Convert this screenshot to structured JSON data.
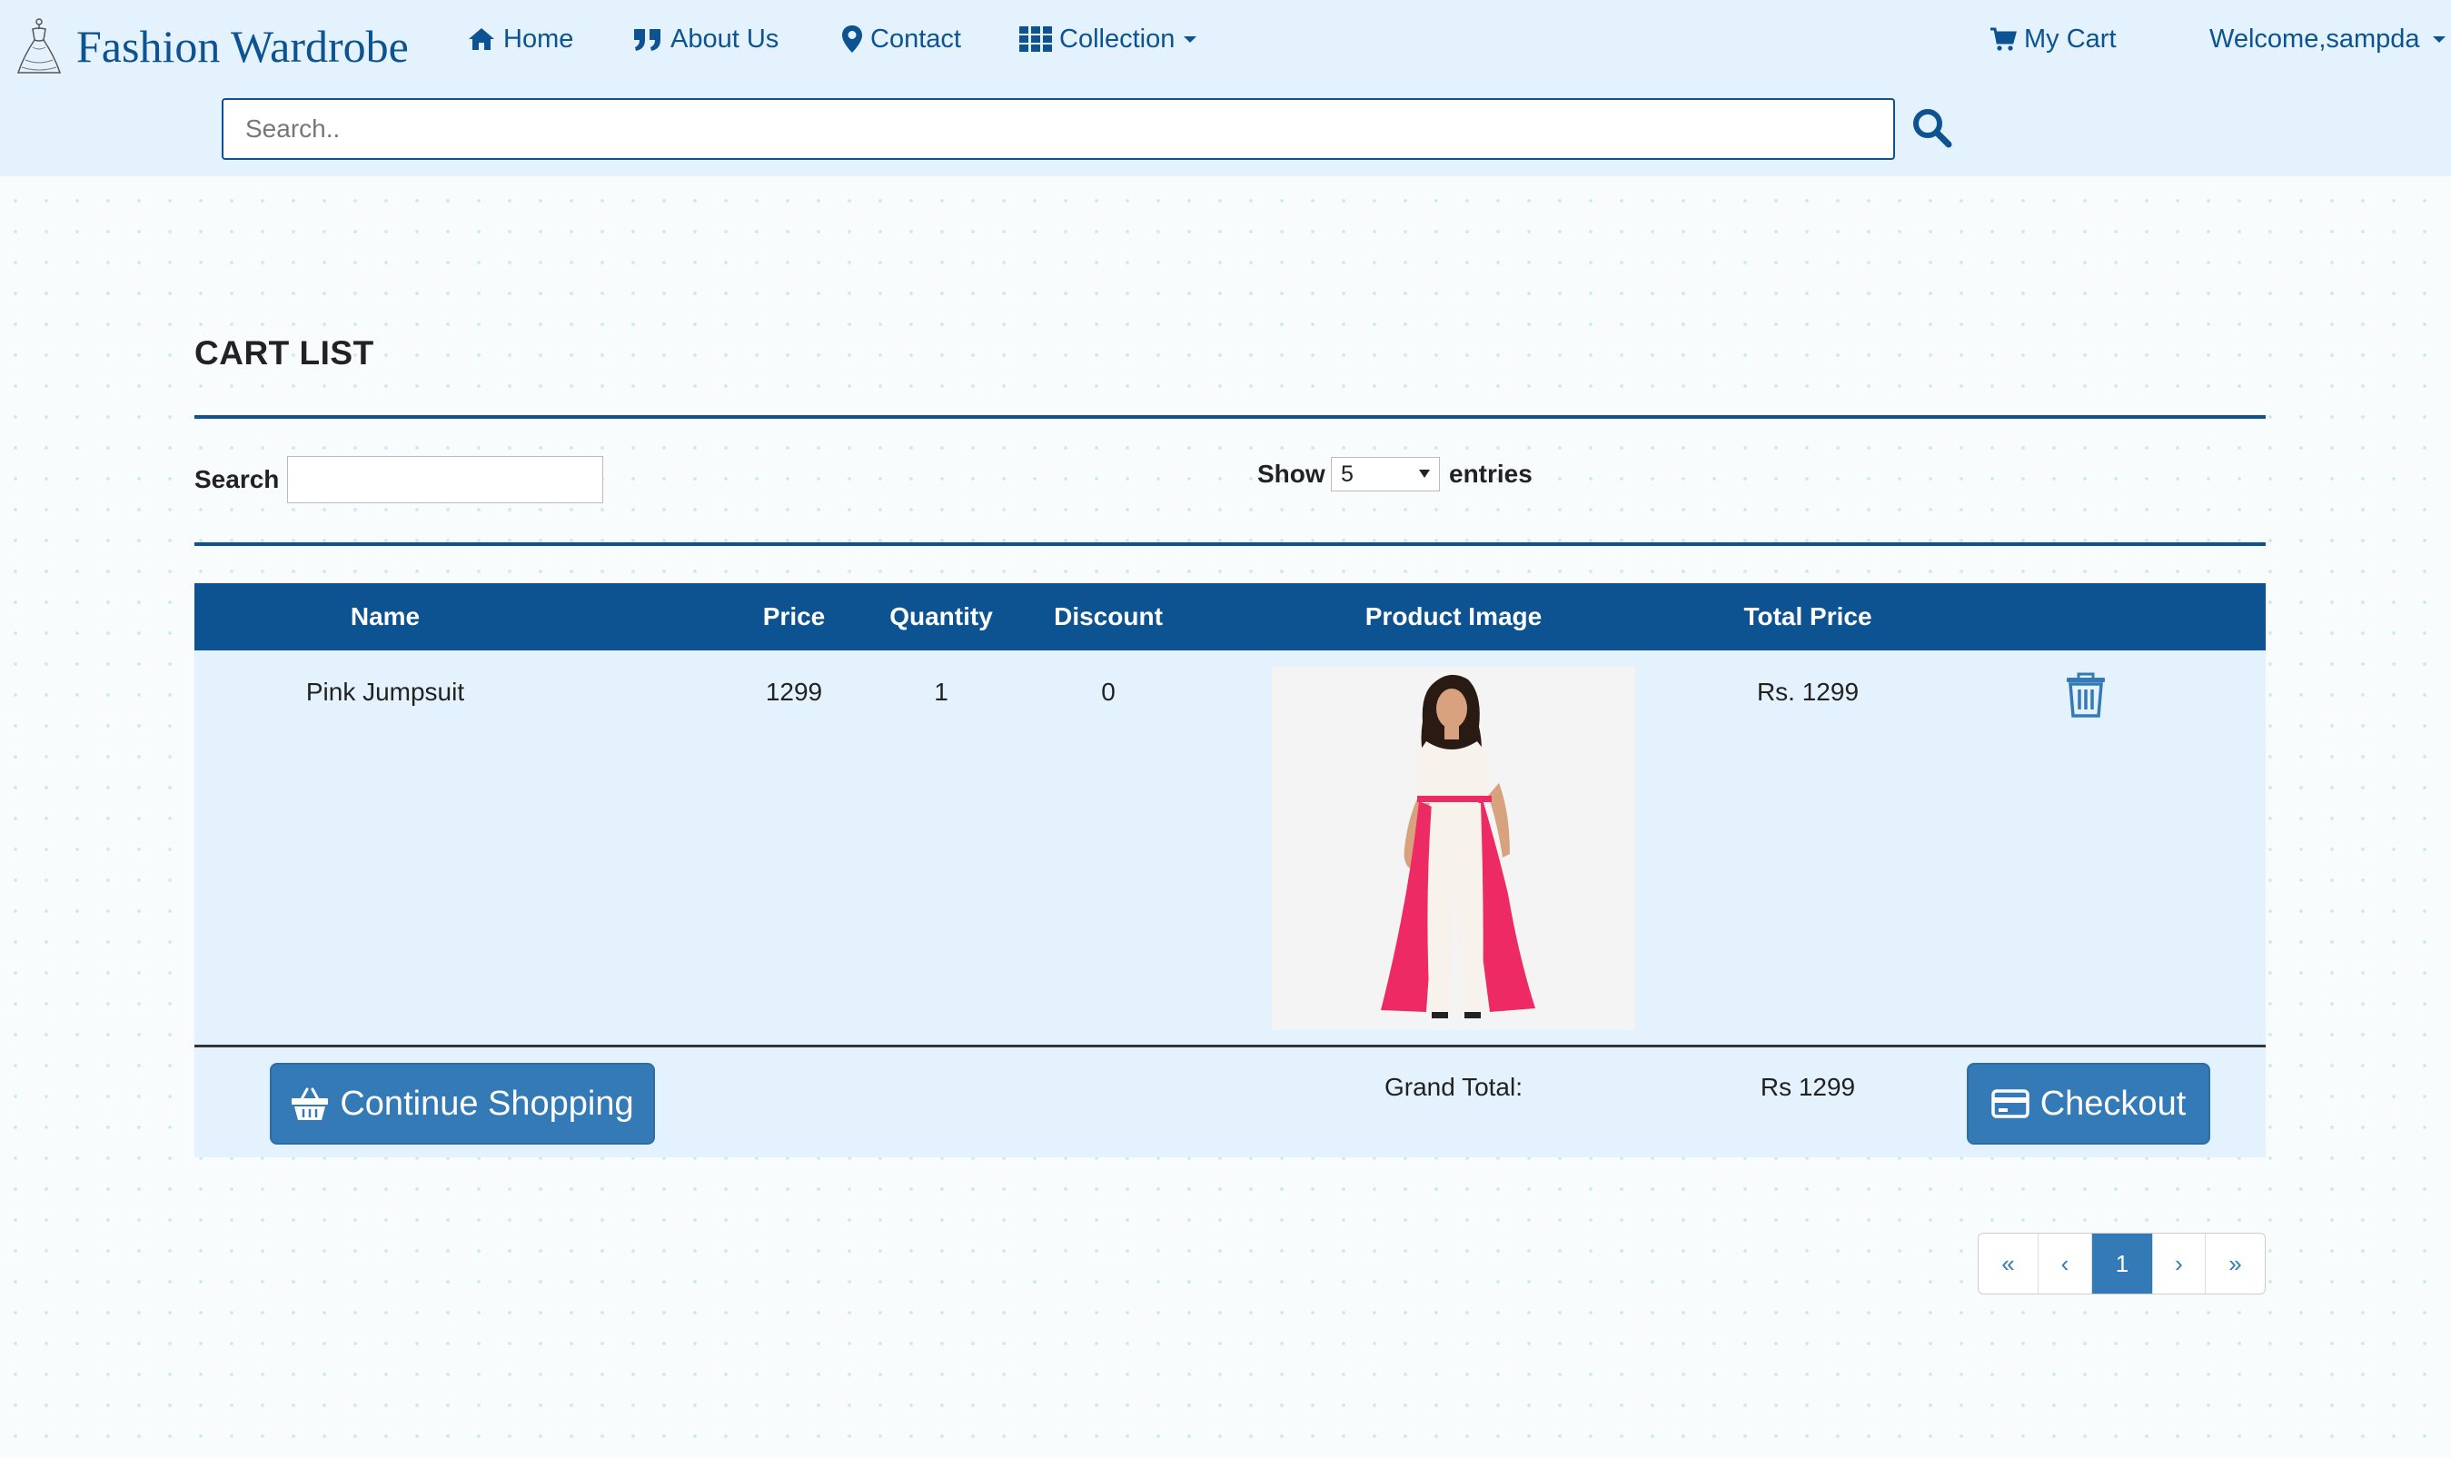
{
  "brand": {
    "name": "Fashion Wardrobe",
    "logo_icon": "dress-mannequin-icon"
  },
  "nav": {
    "home": "Home",
    "about": "About Us",
    "contact": "Contact",
    "collection": "Collection",
    "cart": "My Cart",
    "welcome": "Welcome,sampda"
  },
  "search": {
    "placeholder": "Search.."
  },
  "cart": {
    "title": "CART LIST",
    "search_label": "Search",
    "show_label": "Show",
    "entries_value": "5",
    "entries_label": "entries",
    "columns": [
      "Name",
      "Price",
      "Quantity",
      "Discount",
      "Product Image",
      "Total Price"
    ],
    "rows": [
      {
        "name": "Pink Jumpsuit",
        "price": "1299",
        "quantity": "1",
        "discount": "0",
        "image": "pink-jumpsuit-product-photo",
        "total": "Rs. 1299"
      }
    ],
    "continue_label": "Continue Shopping",
    "grand_total_label": "Grand Total:",
    "grand_total_value": "Rs 1299",
    "checkout_label": "Checkout"
  },
  "pagination": {
    "first": "«",
    "prev": "‹",
    "current": "1",
    "next": "›",
    "last": "»"
  },
  "colors": {
    "primary": "#0d5291",
    "button": "#337ab7",
    "header_bg": "#e3f2fd",
    "jumpsuit_pink": "#ee2a64"
  }
}
